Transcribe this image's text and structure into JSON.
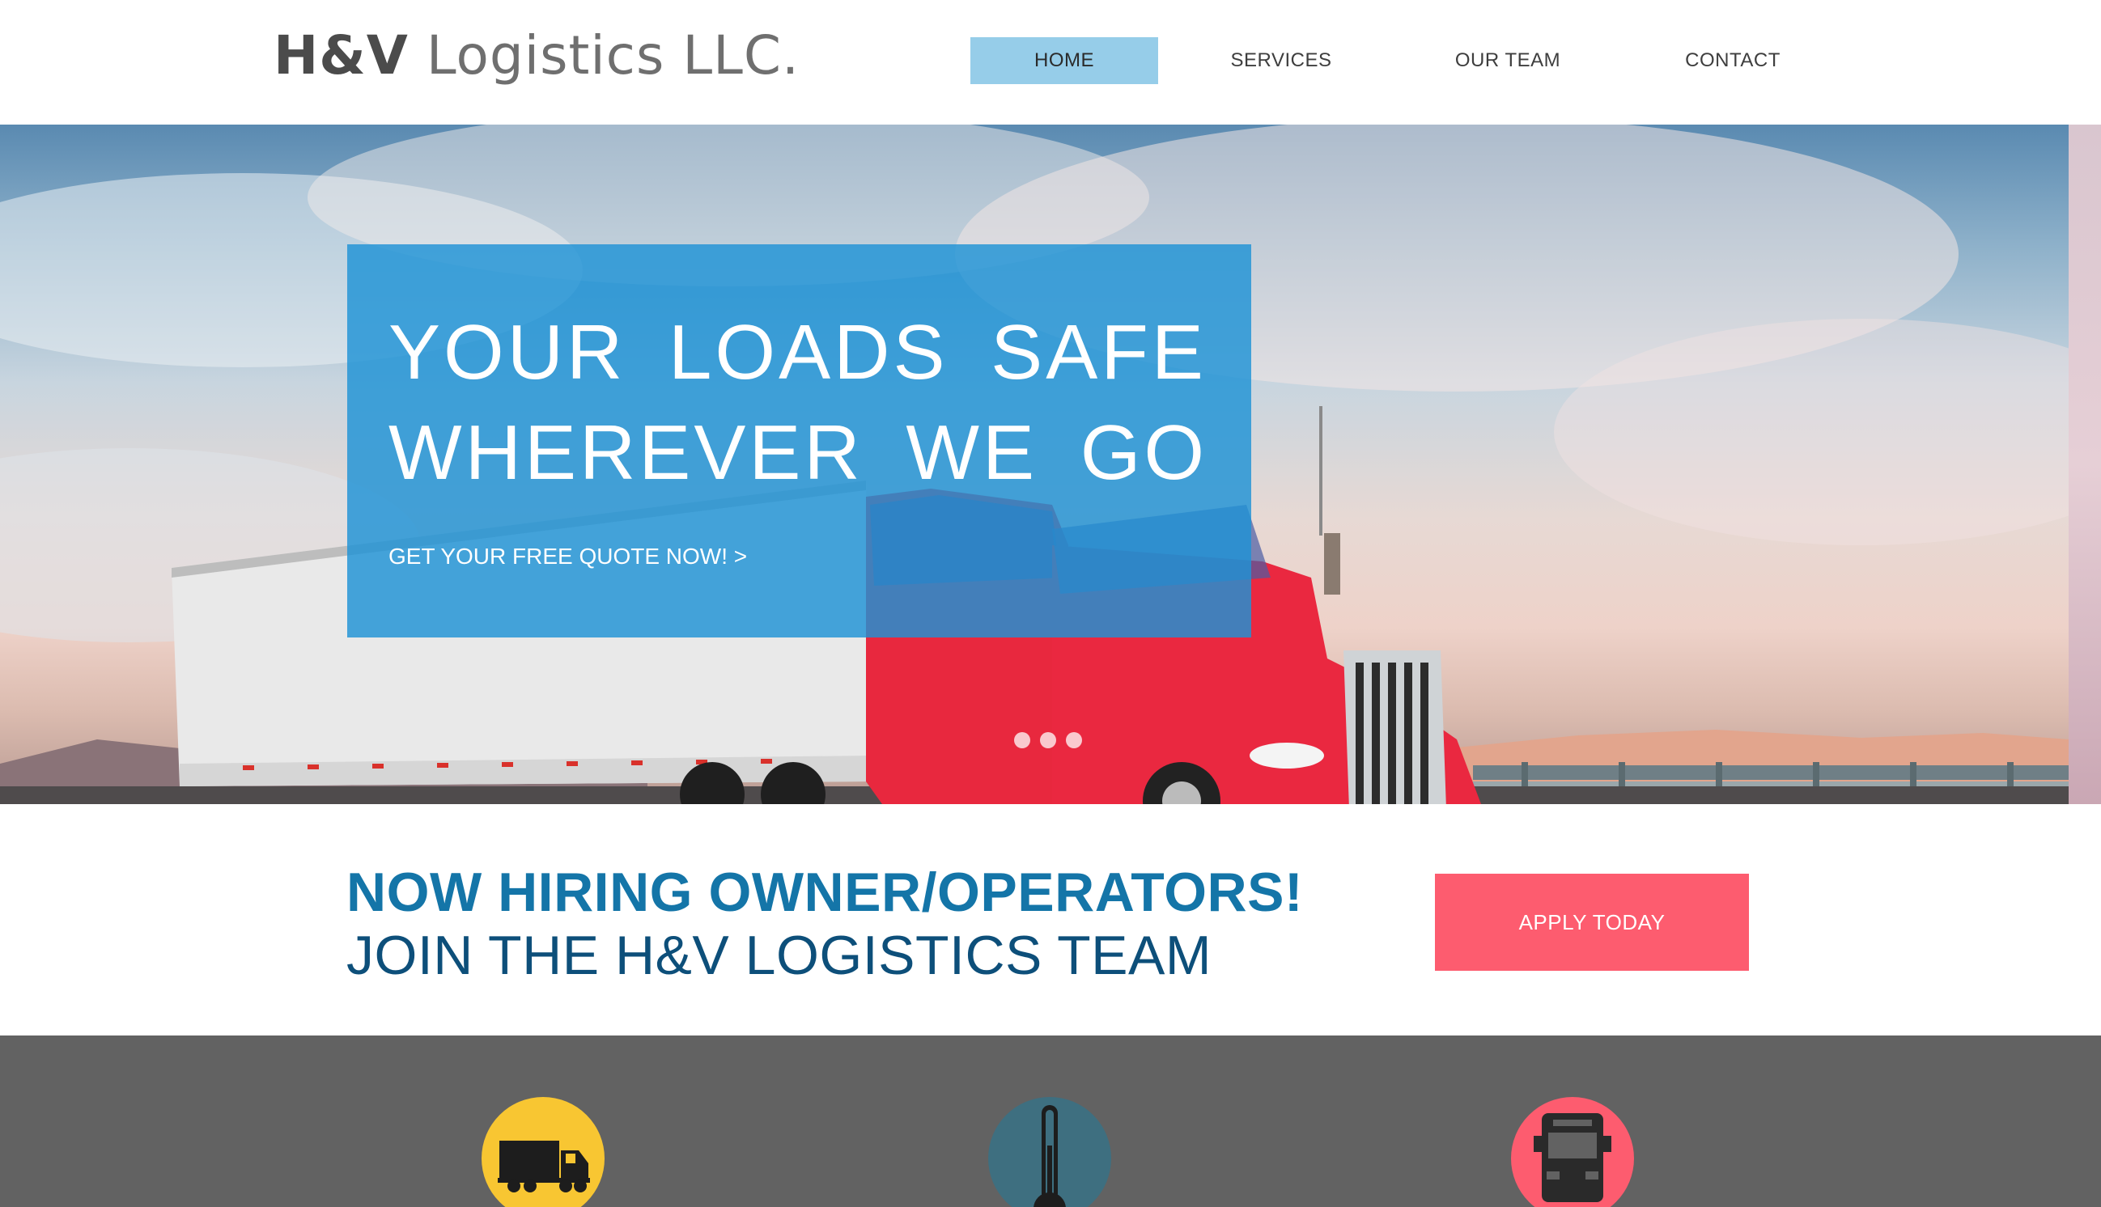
{
  "header": {
    "logo_bold": "H&V",
    "logo_rest": "Logistics LLC.",
    "nav": [
      {
        "label": "HOME",
        "active": true
      },
      {
        "label": "SERVICES",
        "active": false
      },
      {
        "label": "OUR TEAM",
        "active": false
      },
      {
        "label": "CONTACT",
        "active": false
      }
    ]
  },
  "hero": {
    "headline_line1": "YOUR LOADS SAFE",
    "headline_line2": "WHEREVER WE GO",
    "cta": "GET YOUR FREE QUOTE NOW! >",
    "slides": 3,
    "active_slide": 1
  },
  "hiring": {
    "title": "NOW HIRING OWNER/OPERATORS!",
    "subtitle": "JOIN THE H&V LOGISTICS TEAM",
    "button": "APPLY TODAY"
  },
  "services": [
    {
      "icon": "truck-icon",
      "color": "#f8c632"
    },
    {
      "icon": "thermometer-icon",
      "color": "#3e6f80"
    },
    {
      "icon": "bus-front-icon",
      "color": "#fd5c6f"
    }
  ],
  "colors": {
    "nav_active": "#96cde9",
    "hero_box": "#1f93d6",
    "hiring_title": "#1475a8",
    "apply_button": "#fd5c6f",
    "services_bg": "#626262"
  }
}
